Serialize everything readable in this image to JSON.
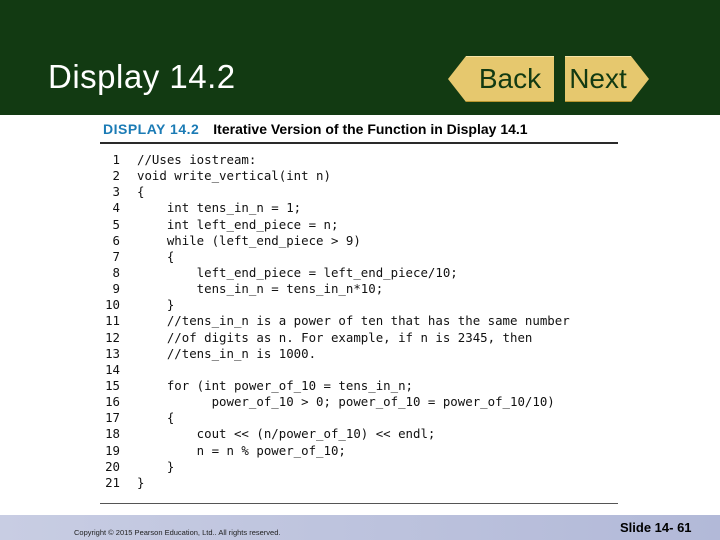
{
  "header": {
    "title": "Display 14.2"
  },
  "nav": {
    "back_label": "Back",
    "next_label": "Next"
  },
  "caption": {
    "label": "DISPLAY 14.2",
    "text": "Iterative Version of the Function in Display 14.1"
  },
  "code_lines": [
    {
      "num": "1",
      "text": "//Uses iostream:"
    },
    {
      "num": "2",
      "text": "void write_vertical(int n)"
    },
    {
      "num": "3",
      "text": "{"
    },
    {
      "num": "4",
      "text": "    int tens_in_n = 1;"
    },
    {
      "num": "5",
      "text": "    int left_end_piece = n;"
    },
    {
      "num": "6",
      "text": "    while (left_end_piece > 9)"
    },
    {
      "num": "7",
      "text": "    {"
    },
    {
      "num": "8",
      "text": "        left_end_piece = left_end_piece/10;"
    },
    {
      "num": "9",
      "text": "        tens_in_n = tens_in_n*10;"
    },
    {
      "num": "10",
      "text": "    }"
    },
    {
      "num": "11",
      "text": "    //tens_in_n is a power of ten that has the same number"
    },
    {
      "num": "12",
      "text": "    //of digits as n. For example, if n is 2345, then"
    },
    {
      "num": "13",
      "text": "    //tens_in_n is 1000."
    },
    {
      "num": "14",
      "text": ""
    },
    {
      "num": "15",
      "text": "    for (int power_of_10 = tens_in_n;"
    },
    {
      "num": "16",
      "text": "          power_of_10 > 0; power_of_10 = power_of_10/10)"
    },
    {
      "num": "17",
      "text": "    {"
    },
    {
      "num": "18",
      "text": "        cout << (n/power_of_10) << endl;"
    },
    {
      "num": "19",
      "text": "        n = n % power_of_10;"
    },
    {
      "num": "20",
      "text": "    }"
    },
    {
      "num": "21",
      "text": "}"
    }
  ],
  "footer": {
    "copyright": "Copyright © 2015 Pearson Education, Ltd.. All rights reserved.",
    "slide": "Slide 14- 61"
  },
  "colors": {
    "header_bg": "#123a12",
    "button": "#e6c86e",
    "caption_label": "#1b7bb5",
    "footer": "#b2b9d8"
  }
}
